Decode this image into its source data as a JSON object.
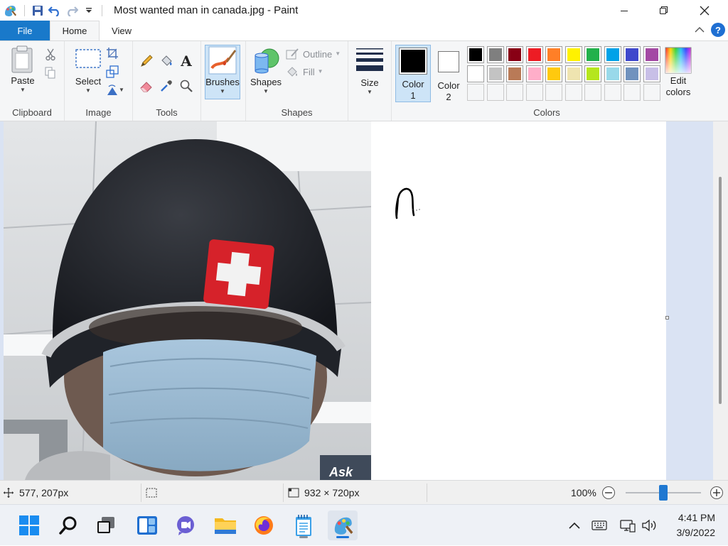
{
  "window": {
    "title": "Most wanted man in canada.jpg - Paint"
  },
  "tabs": {
    "file": "File",
    "home": "Home",
    "view": "View"
  },
  "ribbon": {
    "clipboard": {
      "paste": "Paste",
      "group": "Clipboard"
    },
    "image": {
      "select": "Select",
      "group": "Image"
    },
    "tools": {
      "group": "Tools"
    },
    "brushes": {
      "label": "Brushes"
    },
    "shapes": {
      "shapes": "Shapes",
      "outline": "Outline",
      "fill": "Fill",
      "group": "Shapes"
    },
    "size": {
      "label": "Size"
    },
    "colors": {
      "color1_l1": "Color",
      "color1_l2": "1",
      "color2_l1": "Color",
      "color2_l2": "2",
      "edit_l1": "Edit",
      "edit_l2": "colors",
      "group": "Colors",
      "color1_value": "#000000",
      "color2_value": "#ffffff",
      "palette_row1": [
        "#000000",
        "#7f7f7f",
        "#880015",
        "#ed1c24",
        "#ff7f27",
        "#fff200",
        "#22b14c",
        "#00a2e8",
        "#3f48cc",
        "#a349a4"
      ],
      "palette_row2": [
        "#ffffff",
        "#c3c3c3",
        "#b97a57",
        "#ffaec9",
        "#ffc90e",
        "#efe4b0",
        "#b5e61d",
        "#99d9ea",
        "#7092be",
        "#c8bfe7"
      ]
    }
  },
  "canvas": {
    "image_description": "Photo of a person wearing a black beanie with a Swiss flag patch and a blue surgical mask",
    "poster_text": "Ask"
  },
  "status": {
    "cursor_pos": "577, 207px",
    "image_size": "932 × 720px",
    "zoom": "100%"
  },
  "taskbar": {
    "time": "4:41 PM",
    "date": "3/9/2022"
  }
}
